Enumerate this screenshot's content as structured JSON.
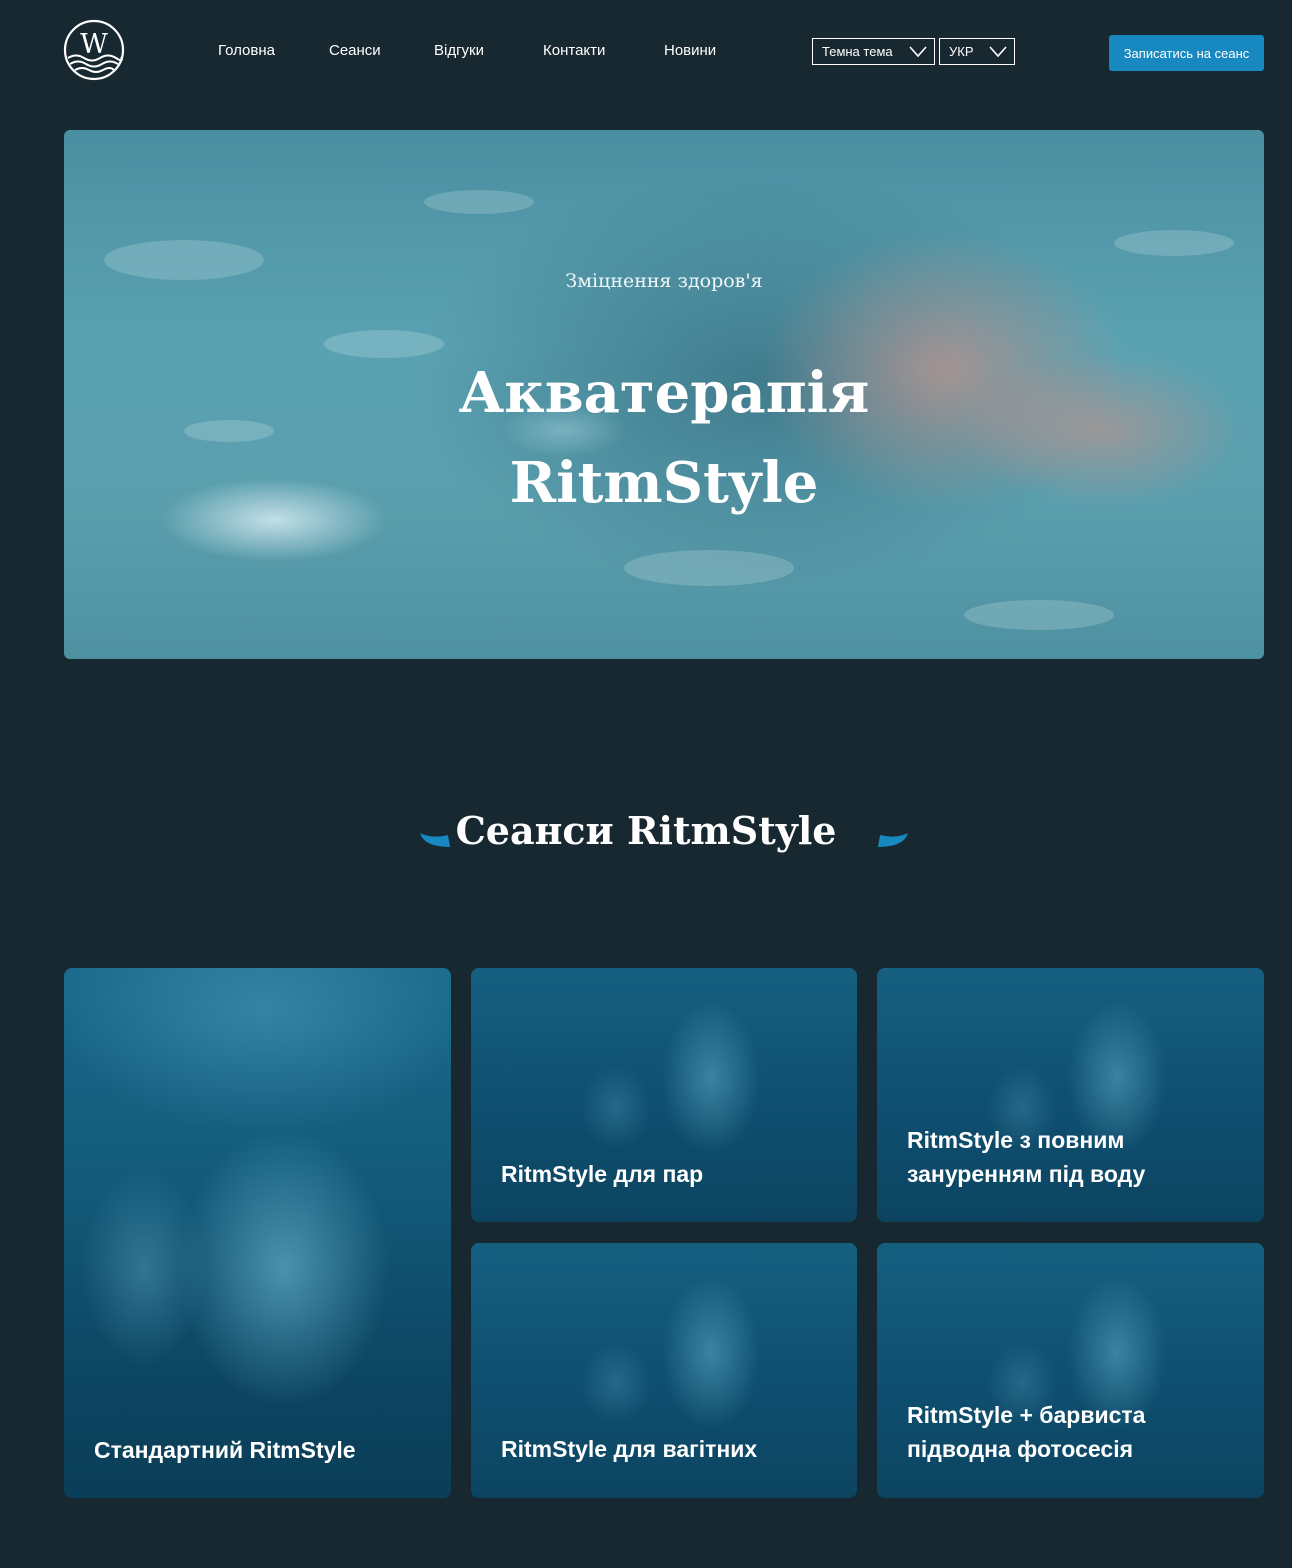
{
  "header": {
    "logo_letter": "W",
    "nav": [
      {
        "label": "Головна"
      },
      {
        "label": "Сеанси"
      },
      {
        "label": "Відгуки"
      },
      {
        "label": "Контакти"
      },
      {
        "label": "Новини"
      }
    ],
    "theme_select": {
      "value": "Темна тема"
    },
    "lang_select": {
      "value": "УКР"
    },
    "cta_label": "Записатись на сеанс"
  },
  "hero": {
    "subtitle": "Зміцнення здоров'я",
    "title_line1": "Акватерапія",
    "title_line2": "RitmStyle"
  },
  "sessions": {
    "title": "Сеанси RitmStyle",
    "cards": [
      {
        "label": "Стандартний RitmStyle"
      },
      {
        "label": "RitmStyle для пар"
      },
      {
        "label": "RitmStyle з повним зануренням під воду"
      },
      {
        "label": "RitmStyle для вагітних"
      },
      {
        "label": "RitmStyle + барвиста підводна фотосесія"
      }
    ]
  },
  "colors": {
    "background": "#172830",
    "accent": "#1788c0",
    "card": "#0c4460"
  },
  "icons": {
    "logo": "wave-logo-icon",
    "select_chevron": "chevron-down-icon",
    "title_decor": "leaf-icon"
  }
}
